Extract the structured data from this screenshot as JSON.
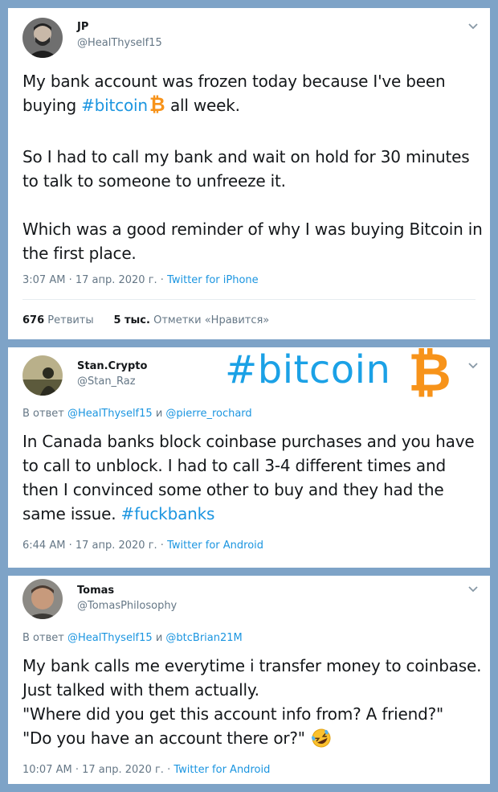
{
  "colors": {
    "background": "#7ea3c7",
    "link": "#1b95e0",
    "text": "#14171a",
    "muted": "#657786",
    "bitcoin_orange": "#f7931a"
  },
  "overlay": {
    "text": "#bitcoin"
  },
  "tweets": [
    {
      "name": "JP",
      "handle": "@HealThyself15",
      "body": {
        "p1_a": "My bank account was frozen today because I've been buying ",
        "p1_hashtag": "#bitcoin",
        "p1_b": " all week.",
        "p2": "So I had to call my bank and wait on hold for 30 minutes to talk to someone to unfreeze it.",
        "p3": "Which was a good reminder of why I was buying Bitcoin in the first place."
      },
      "time": "3:07 AM · 17 апр. 2020 г. · ",
      "source": "Twitter for iPhone",
      "retweets_count": "676",
      "retweets_label": "Ретвиты",
      "likes_count": "5 тыс.",
      "likes_label": "Отметки «Нравится»"
    },
    {
      "name": "Stan.Crypto",
      "handle": "@Stan_Raz",
      "reply_prefix": "В ответ ",
      "reply_user1": "@HealThyself15",
      "reply_and": " и ",
      "reply_user2": "@pierre_rochard",
      "body_text": "In Canada banks block coinbase purchases and you have to call to unblock. I had to call 3-4 different times and then I convinced some other to buy and they had the same issue. ",
      "body_hashtag": "#fuckbanks",
      "time": "6:44 AM · 17 апр. 2020 г. · ",
      "source": "Twitter for Android"
    },
    {
      "name": "Tomas",
      "handle": "@TomasPhilosophy",
      "reply_prefix": "В ответ ",
      "reply_user1": "@HealThyself15",
      "reply_and": " и ",
      "reply_user2": "@btcBrian21M",
      "body_l1": "My bank calls me everytime i transfer money to coinbase. Just talked with them actually.",
      "body_l2": "\"Where did you get this account info from? A friend?\"",
      "body_l3": "\"Do you have an account there or?\" ",
      "emoji": "rolling-on-floor-laughing-emoji",
      "time": "10:07 AM · 17 апр. 2020 г. · ",
      "source": "Twitter for Android"
    }
  ]
}
